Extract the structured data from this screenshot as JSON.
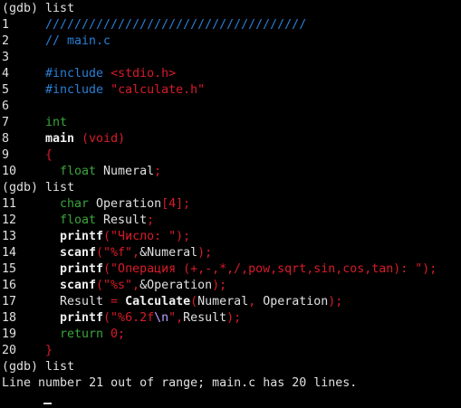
{
  "prompt": "(gdb)",
  "commands": {
    "list1": "list",
    "list2": "list",
    "list3": "list"
  },
  "lines": {
    "l1": {
      "num": "1",
      "text": "////////////////////////////////////"
    },
    "l2": {
      "num": "2",
      "text": "// main.c"
    },
    "l3": {
      "num": "3"
    },
    "l4": {
      "num": "4",
      "pre": "#include",
      "inc": "<stdio.h>"
    },
    "l5": {
      "num": "5",
      "pre": "#include",
      "inc": "\"calculate.h\""
    },
    "l6": {
      "num": "6"
    },
    "l7": {
      "num": "7",
      "type": "int"
    },
    "l8": {
      "num": "8",
      "name": "main",
      "args": "(void)"
    },
    "l9": {
      "num": "9",
      "brace": "{"
    },
    "l10": {
      "num": "10",
      "type": "float",
      "rest": " Numeral",
      "semi": ";"
    },
    "l11": {
      "num": "11",
      "type": "char",
      "rest": " Operation",
      "idx": "[4];"
    },
    "l12": {
      "num": "12",
      "type": "float",
      "rest": " Result",
      "semi": ";"
    },
    "l13": {
      "num": "13",
      "fn": "printf",
      "args": "(\"Число: \");"
    },
    "l14": {
      "num": "14",
      "fn": "scanf",
      "a1": "(\"%f\",",
      "a2": "&Numeral",
      "a3": ");"
    },
    "l15": {
      "num": "15",
      "fn": "printf",
      "args": "(\"Операция (+,-,*,/,pow,sqrt,sin,cos,tan): \");"
    },
    "l16": {
      "num": "16",
      "fn": "scanf",
      "a1": "(\"%s\",",
      "a2": "&Operation",
      "a3": ");"
    },
    "l17": {
      "num": "17",
      "p1": "Result ",
      "eq": "=",
      "sp": " ",
      "fn": "Calculate",
      "a1": "(",
      "a2": "Numeral",
      "a3": ", ",
      "a4": "Operation",
      "a5": ");"
    },
    "l18": {
      "num": "18",
      "fn": "printf",
      "a1": "(\"%6.2f",
      "esc": "\\n",
      "a2": "\",",
      "a3": "Result",
      "a4": ");"
    },
    "l19": {
      "num": "19",
      "kw": "return",
      "val": " 0;"
    },
    "l20": {
      "num": "20",
      "brace": "}"
    }
  },
  "error_message": "Line number 21 out of range; main.c has 20 lines."
}
